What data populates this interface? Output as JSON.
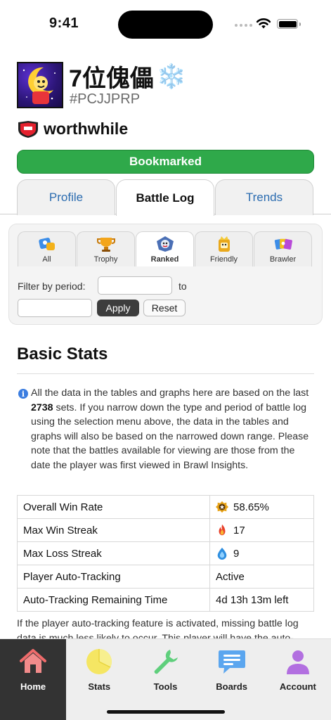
{
  "status_bar": {
    "time": "9:41"
  },
  "profile": {
    "name": "7位傀儡",
    "name_emoji": "❄️",
    "tag": "#PCJJPRP",
    "club_name": "worthwhile"
  },
  "bookmark": {
    "label": "Bookmarked",
    "color": "#2fa94a"
  },
  "top_tabs": [
    {
      "label": "Profile",
      "active": false
    },
    {
      "label": "Battle Log",
      "active": true
    },
    {
      "label": "Trends",
      "active": false
    }
  ],
  "mode_tabs": [
    {
      "label": "All",
      "icon": "all-modes-icon",
      "active": false
    },
    {
      "label": "Trophy",
      "icon": "trophy-icon",
      "active": false
    },
    {
      "label": "Ranked",
      "icon": "ranked-icon",
      "active": true
    },
    {
      "label": "Friendly",
      "icon": "friendly-icon",
      "active": false
    },
    {
      "label": "Brawler",
      "icon": "brawler-cards-icon",
      "active": false
    }
  ],
  "filter": {
    "label": "Filter by period:",
    "to_label": "to",
    "start_value": "",
    "end_value": "",
    "apply_label": "Apply",
    "reset_label": "Reset"
  },
  "basic_stats": {
    "title": "Basic Stats",
    "info_pre": "All the data in the tables and graphs here are based on the last ",
    "info_count": "2738",
    "info_post": " sets. If you narrow down the type and period of battle log using the selection menu above, the data in the tables and graphs will also be based on the narrowed down range. Please note that the battles available for viewing are those from the date the player was first viewed in Brawl Insights.",
    "rows": [
      {
        "label": "Overall Win Rate",
        "value": "58.65%",
        "icon": "star-badge-icon"
      },
      {
        "label": "Max Win Streak",
        "value": "17",
        "icon": "fire-icon"
      },
      {
        "label": "Max Loss Streak",
        "value": "9",
        "icon": "water-drop-icon"
      },
      {
        "label": "Player Auto-Tracking",
        "value": "Active",
        "icon": ""
      },
      {
        "label": "Auto-Tracking Remaining Time",
        "value": "4d 13h 13m left",
        "icon": ""
      }
    ],
    "footer": "If the player auto-tracking feature is activated, missing battle log data is much less likely to occur. This player will have the auto-"
  },
  "bottom_nav": [
    {
      "label": "Home",
      "icon": "home-icon",
      "active": true
    },
    {
      "label": "Stats",
      "icon": "pie-chart-icon",
      "active": false
    },
    {
      "label": "Tools",
      "icon": "wrench-icon",
      "active": false
    },
    {
      "label": "Boards",
      "icon": "chat-bubble-icon",
      "active": false
    },
    {
      "label": "Account",
      "icon": "person-icon",
      "active": false
    }
  ]
}
